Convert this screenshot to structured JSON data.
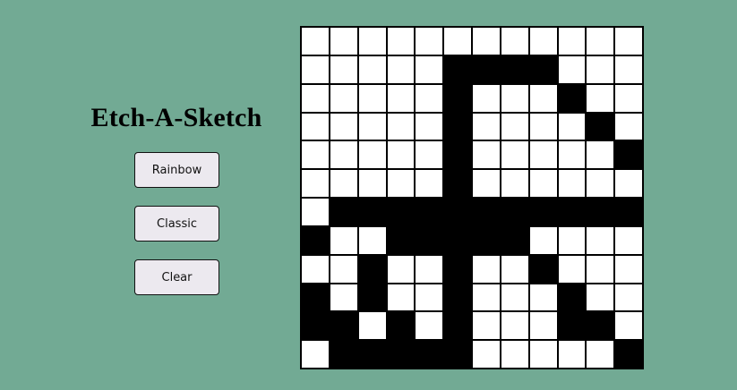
{
  "app": {
    "title": "Etch-A-Sketch"
  },
  "buttons": {
    "rainbow_label": "Rainbow",
    "classic_label": "Classic",
    "clear_label": "Clear"
  },
  "grid": {
    "rows": 12,
    "cols": 12,
    "cells": [
      "000000000000",
      "000001111000",
      "000001000100",
      "000001000010",
      "000001000001",
      "000001000000",
      "011111111111",
      "100111110000",
      "001001001000",
      "101001000100",
      "110101000110",
      "011111000001"
    ],
    "fill_color": "#000000",
    "empty_color": "#ffffff"
  },
  "colors": {
    "background": "#72aa94",
    "button_bg": "#ece9ef"
  }
}
